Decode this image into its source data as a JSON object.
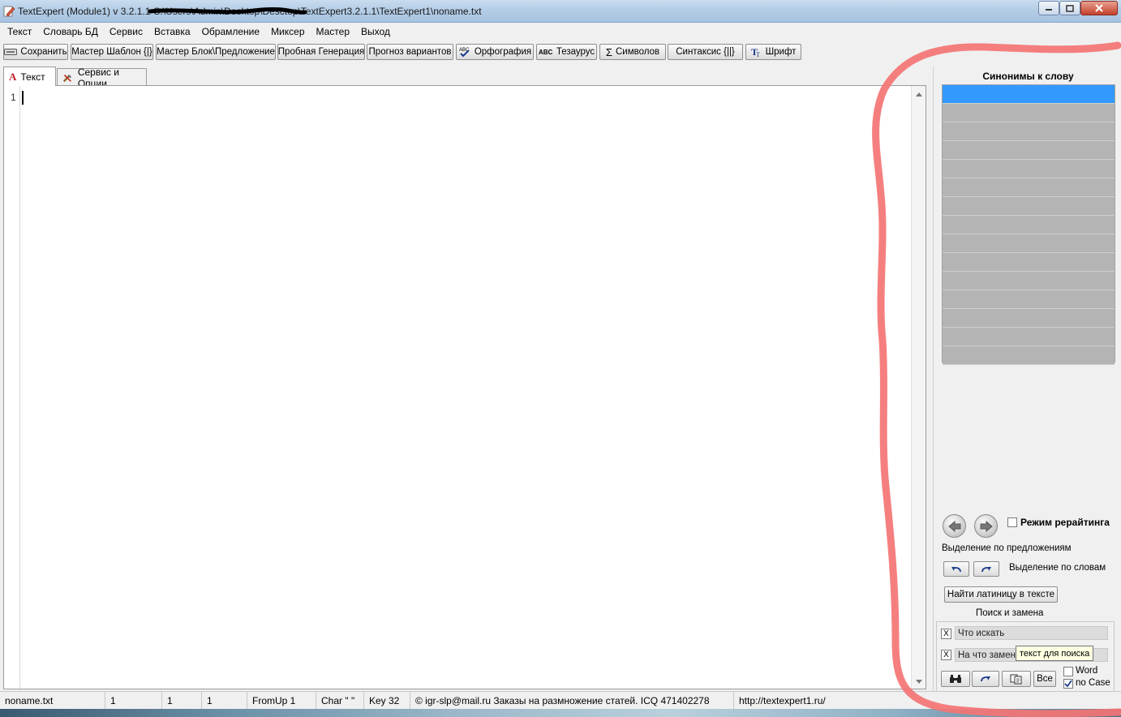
{
  "window": {
    "title": "TextExpert (Module1) v 3.2.1.1   C:\\Users\\Admin\\Desktop\\Desctop\\TextExpert3.2.1.1\\TextExpert1\\noname.txt",
    "icons": {
      "app": "notepad-pencil-icon",
      "minimize": "minimize-icon",
      "maximize": "maximize-icon",
      "close": "close-icon"
    }
  },
  "menu": [
    "Текст",
    "Словарь БД",
    "Сервис",
    "Вставка",
    "Обрамление",
    "Миксер",
    "Мастер",
    "Выход"
  ],
  "toolbar": {
    "save": "Сохранить",
    "template_wizard": "Мастер Шаблон {|}",
    "block_wizard": "Мастер Блок\\Предложение",
    "test_generation": "Пробная Генерация",
    "variants_forecast": "Прогноз вариантов",
    "spelling": "Орфография",
    "thesaurus": "Тезаурус",
    "symbols": "Символов",
    "syntax": "Синтаксис {||}",
    "font": "Шрифт"
  },
  "tabs": [
    {
      "label": "Текст",
      "icon": "text-a-icon",
      "active": true
    },
    {
      "label": "Сервис и Опции",
      "icon": "tools-icon",
      "active": false
    }
  ],
  "editor": {
    "line_number": "1",
    "content": ""
  },
  "right_panel": {
    "synonyms_title": "Синонимы к слову",
    "synonym_rows": 15,
    "rewrite_mode_label": "Режим рерайтинга",
    "rewrite_mode_checked": false,
    "select_by_sentence": "Выделение по предложениям",
    "select_by_word": "Выделение по словам",
    "find_latin": "Найти латиницу в тексте",
    "search_replace_title": "Поиск и замена",
    "find_placeholder": "Что искать",
    "replace_placeholder": "На что замени",
    "tooltip": "текст для поиска",
    "replace_all": "Все",
    "word_label": "Word",
    "word_checked": false,
    "nocase_label": "no Case",
    "nocase_checked": true,
    "clear_mark": "X"
  },
  "status": {
    "file": "noname.txt",
    "c1": "1",
    "c2": "1",
    "c3": "1",
    "fromup": "FromUp  1",
    "char": "Char  \" \"",
    "key": "Key  32",
    "contact": "© igr-slp@mail.ru Заказы на размножение статей. ICQ 471402278",
    "url": "http://textexpert1.ru/"
  },
  "colors": {
    "selection": "#3399ff",
    "annotation": "#f47474",
    "titlebar": "#b4cde6"
  }
}
